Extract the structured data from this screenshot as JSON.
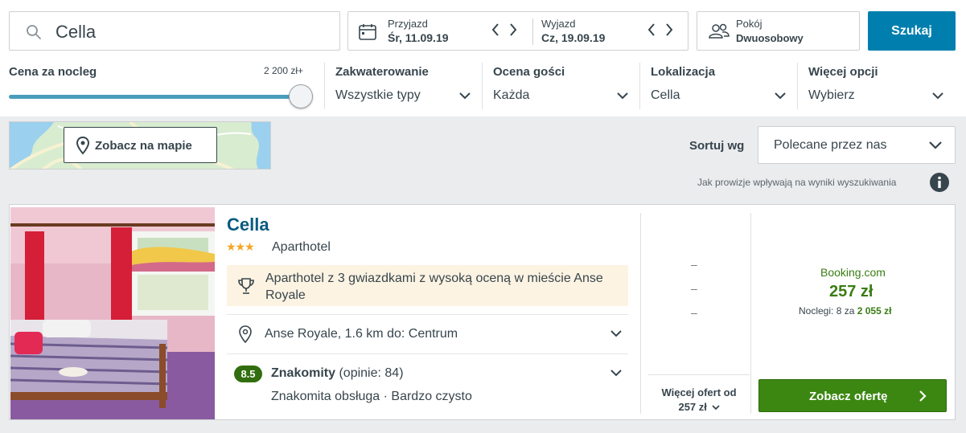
{
  "search": {
    "value": "Cella"
  },
  "dates": {
    "checkin_label": "Przyjazd",
    "checkin_value": "Śr, 11.09.19",
    "checkout_label": "Wyjazd",
    "checkout_value": "Cz, 19.09.19"
  },
  "rooms": {
    "label": "Pokój",
    "value": "Dwuosobowy"
  },
  "search_button": "Szukaj",
  "filters": {
    "price": {
      "title": "Cena za nocleg",
      "max": "2 200 zł+",
      "level": 1.0
    },
    "accommodation": {
      "title": "Zakwaterowanie",
      "value": "Wszystkie typy"
    },
    "rating": {
      "title": "Ocena gości",
      "value": "Każda"
    },
    "location": {
      "title": "Lokalizacja",
      "value": "Cella"
    },
    "more": {
      "title": "Więcej opcji",
      "value": "Wybierz"
    }
  },
  "map": {
    "button": "Zobacz na mapie"
  },
  "sort": {
    "label": "Sortuj wg",
    "value": "Polecane przez nas"
  },
  "commission_note": "Jak prowizje wpływają na wyniki wyszukiwania",
  "hotel": {
    "name": "Cella",
    "stars": "★★★",
    "type": "Aparthotel",
    "award": "Aparthotel z 3 gwiazdkami z wysoką oceną w mieście Anse Royale",
    "location": "Anse Royale, 1.6 km do: Centrum",
    "score": "8.5",
    "rating_word": "Znakomity",
    "rating_count": "(opinie: 84)",
    "highlights": "Znakomita obsługa · Bardzo czysto",
    "dashes": [
      "–",
      "–",
      "–"
    ],
    "more_offers_line1": "Więcej ofert od",
    "more_offers_line2": "257 zł",
    "provider": "Booking.com",
    "price": "257 zł",
    "nights_prefix": "Noclegi: 8 za",
    "nights_total": "2 055 zł",
    "offer_button": "Zobacz ofertę"
  },
  "colors": {
    "primary_blue": "#007faf",
    "green_button": "#3c8712",
    "price_green": "#3a7d14",
    "badge_green": "#316e0f",
    "hotel_name_blue": "#0a5a81"
  }
}
